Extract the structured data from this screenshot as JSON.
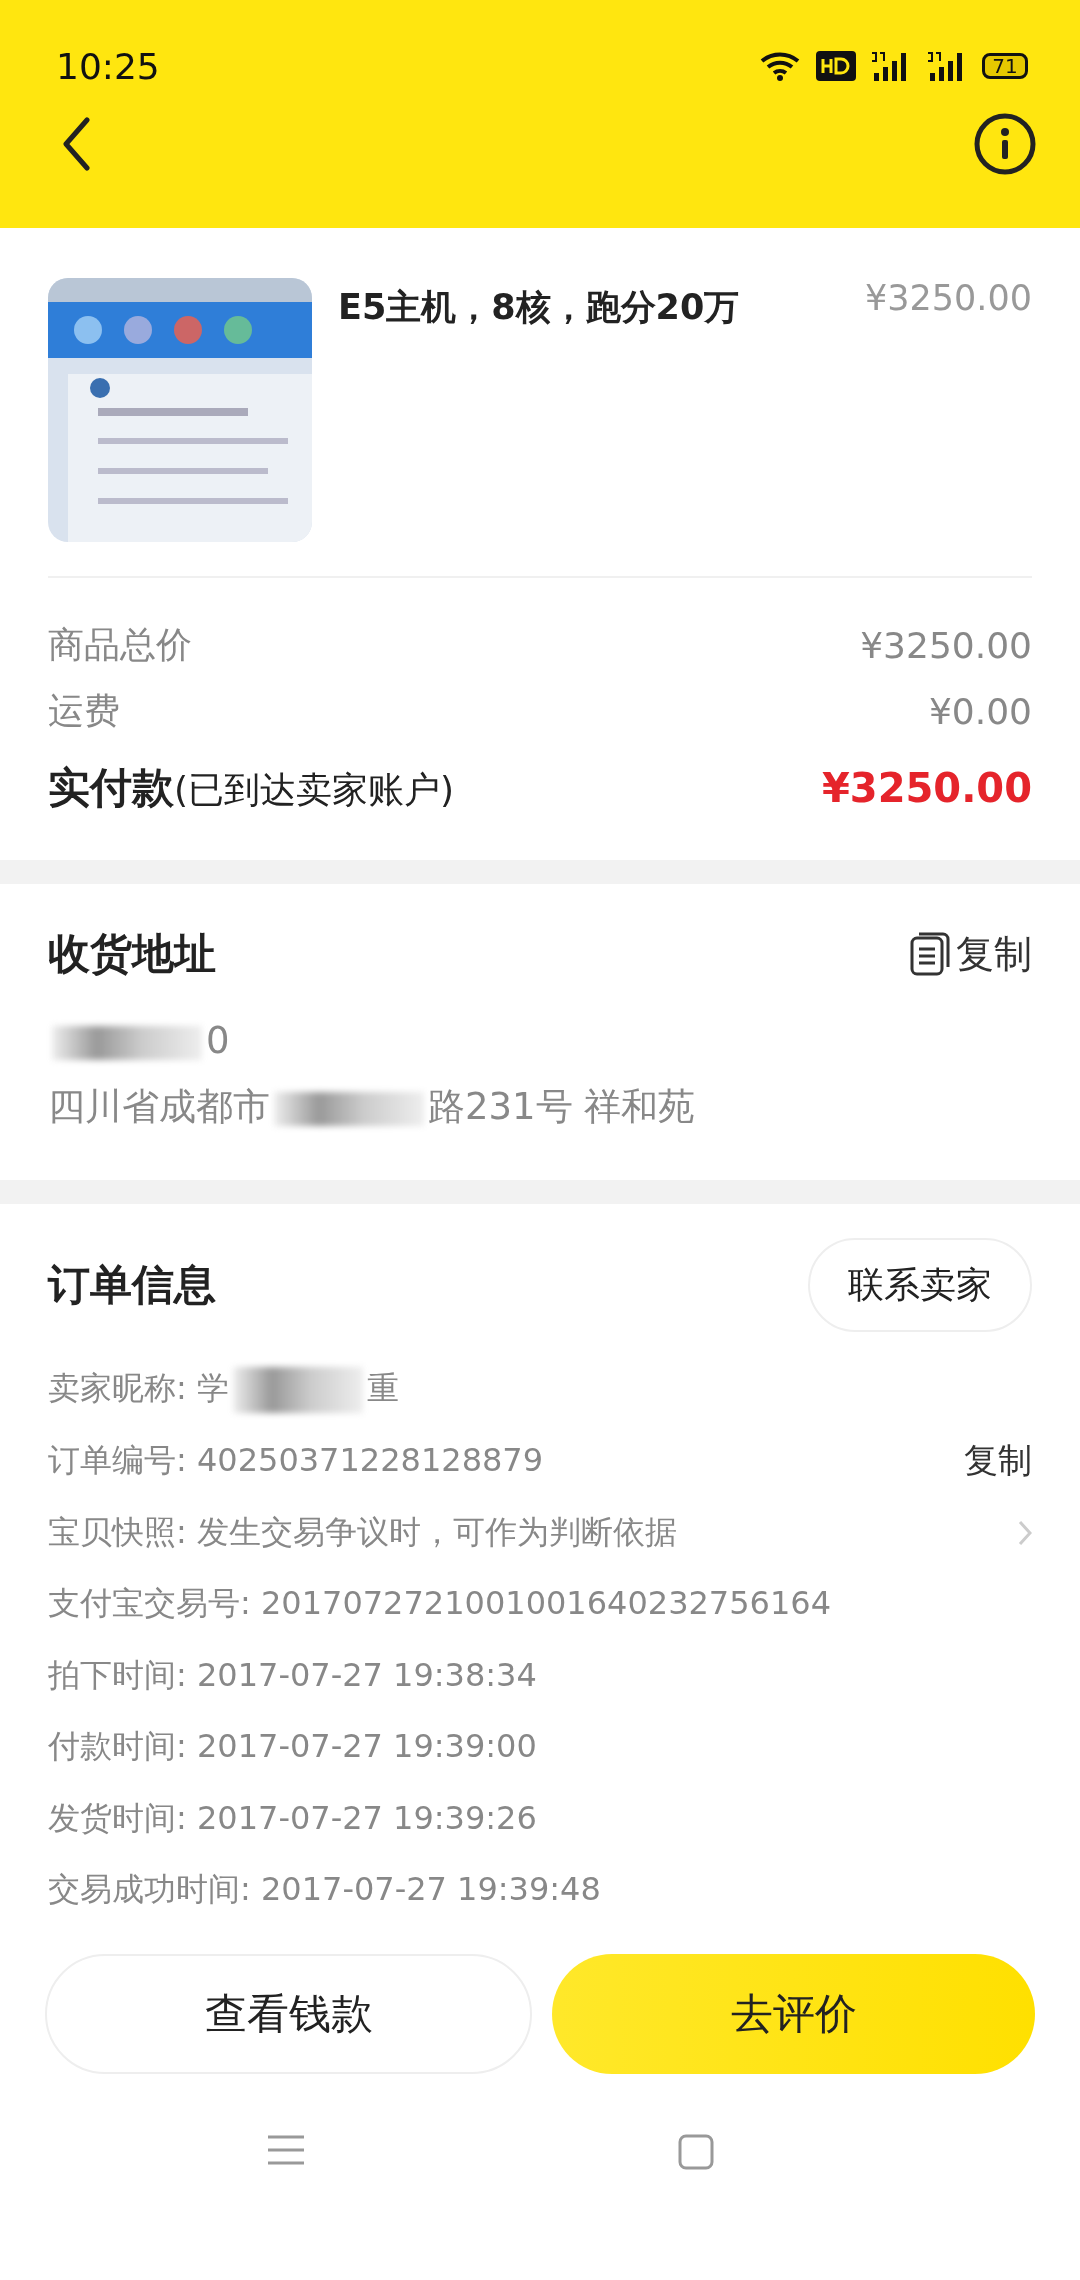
{
  "status_bar": {
    "time": "10:25",
    "battery": "71"
  },
  "product": {
    "kind": "picture",
    "title": "E5主机，8核，跑分20万",
    "price": "¥3250.00"
  },
  "summary": [
    {
      "kind": "plain",
      "label": "商品总价",
      "value": "¥3250.00"
    },
    {
      "kind": "plain",
      "label": "运费",
      "value": "¥0.00"
    },
    {
      "kind": "total",
      "label": "实付款",
      "note": "(已到达卖家账户)",
      "value": "¥3250.00"
    }
  ],
  "address": {
    "title": "收货地址",
    "copy": "复制",
    "lines": [
      [
        {
          "kind": "blur"
        },
        {
          "kind": "text",
          "text": "0"
        }
      ],
      [
        {
          "kind": "text",
          "text": "四川省成都市"
        },
        {
          "kind": "blur"
        },
        {
          "kind": "text",
          "text": "路231号 祥和苑"
        }
      ]
    ]
  },
  "order": {
    "title": "订单信息",
    "contact": "联系卖家",
    "rows": [
      {
        "kind": "plain",
        "parts": [
          {
            "kind": "text",
            "text": "卖家昵称: 学"
          },
          {
            "kind": "blur"
          },
          {
            "kind": "text",
            "text": "重"
          }
        ]
      },
      {
        "kind": "copy",
        "parts": [
          {
            "kind": "text",
            "text": "订单编号: 40250371228128879"
          }
        ],
        "action": "复制"
      },
      {
        "kind": "link",
        "parts": [
          {
            "kind": "text",
            "text": "宝贝快照: 发生交易争议时，可作为判断依据"
          }
        ]
      },
      {
        "kind": "plain",
        "parts": [
          {
            "kind": "text",
            "text": "支付宝交易号: 2017072721001001640232756164"
          }
        ]
      },
      {
        "kind": "plain",
        "parts": [
          {
            "kind": "text",
            "text": "拍下时间: 2017-07-27 19:38:34"
          }
        ]
      },
      {
        "kind": "plain",
        "parts": [
          {
            "kind": "text",
            "text": "付款时间: 2017-07-27 19:39:00"
          }
        ]
      },
      {
        "kind": "plain",
        "parts": [
          {
            "kind": "text",
            "text": "发货时间: 2017-07-27 19:39:26"
          }
        ]
      },
      {
        "kind": "plain",
        "parts": [
          {
            "kind": "text",
            "text": "交易成功时间: 2017-07-27 19:39:48"
          }
        ]
      }
    ]
  },
  "buttons": [
    {
      "kind": "outline",
      "label": "查看钱款"
    },
    {
      "kind": "primary",
      "label": "去评价"
    }
  ]
}
